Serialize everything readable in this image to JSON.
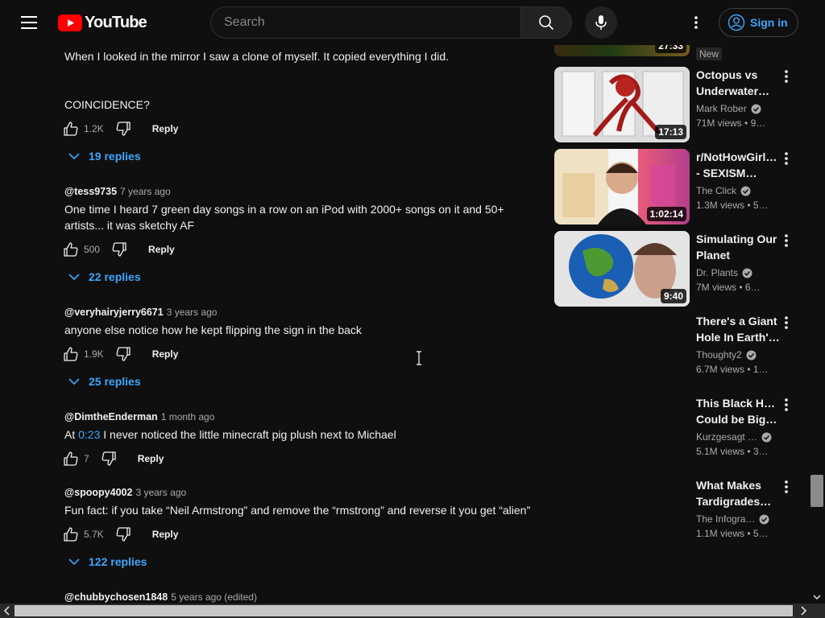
{
  "masthead": {
    "logo_text": "YouTube",
    "search_placeholder": "Search",
    "signin_label": "Sign in"
  },
  "comments": {
    "top_fragment": {
      "line1": "When I looked in the mirror I saw a clone of myself. It copied everything I did.",
      "line2": "COINCIDENCE?",
      "likes": "1.2K",
      "reply_label": "Reply",
      "replies": "19 replies"
    },
    "items": [
      {
        "handle": "@tess9735",
        "age": "7 years ago",
        "line1": "One time I heard 7 green day songs in a row on an iPod with 2000+ songs on it and 50+",
        "line2": "artists... it was sketchy AF",
        "likes": "500",
        "reply_label": "Reply",
        "replies": "22 replies"
      },
      {
        "handle": "@veryhairyjerry6671",
        "age": "3 years ago",
        "line1": "anyone else notice how he kept flipping the sign in the back",
        "likes": "1.9K",
        "reply_label": "Reply",
        "replies": "25 replies"
      },
      {
        "handle": "@DimtheEnderman",
        "age": "1 month ago",
        "text_prefix": "At ",
        "timestamp_link": "0:23",
        "text_suffix": " I never noticed the little minecraft pig plush next to Michael",
        "likes": "7",
        "reply_label": "Reply"
      },
      {
        "handle": "@spoopy4002",
        "age": "3 years ago",
        "line1": "Fun fact: if you take “Neil Armstrong” and remove the “rmstrong” and reverse it you get “alien”",
        "likes": "5.7K",
        "reply_label": "Reply",
        "replies": "122 replies"
      },
      {
        "handle": "@chubbychosen1848",
        "age": "5 years ago (edited)"
      }
    ]
  },
  "sidebar": {
    "top_partial": {
      "duration": "27:33",
      "badge": "New"
    },
    "videos": [
      {
        "title_line1": "Octopus vs",
        "title_line2": "Underwater…",
        "channel": "Mark Rober",
        "views": "71M views",
        "age": "9…",
        "duration": "17:13"
      },
      {
        "title_line1": "r/NotHowGirlsW",
        "title_line2": "- SEXISM…",
        "channel": "The Click",
        "views": "1.3M views",
        "age": "5…",
        "duration": "1:02:14"
      },
      {
        "title_line1": "Simulating Our",
        "title_line2": "Planet",
        "channel": "Dr. Plants",
        "views": "7M views",
        "age": "6…",
        "duration": "9:40"
      },
      {
        "title_line1": "There's a Giant",
        "title_line2": "Hole In Earth's…",
        "channel": "Thoughty2",
        "views": "6.7M views",
        "age": "1…"
      },
      {
        "title_line1": "This Black Hole",
        "title_line2": "Could be Bigg…",
        "channel": "Kurzgesagt …",
        "views": "5.1M views",
        "age": "3…"
      },
      {
        "title_line1": "What Makes",
        "title_line2": "Tardigrades…",
        "channel": "The Infogra…",
        "views": "1.1M views",
        "age": "5…"
      }
    ]
  },
  "colors": {
    "background": "#0f0f0f",
    "link_blue": "#3ea6ff",
    "youtube_red": "#ff0000",
    "secondary_text": "#aaaaaa"
  }
}
